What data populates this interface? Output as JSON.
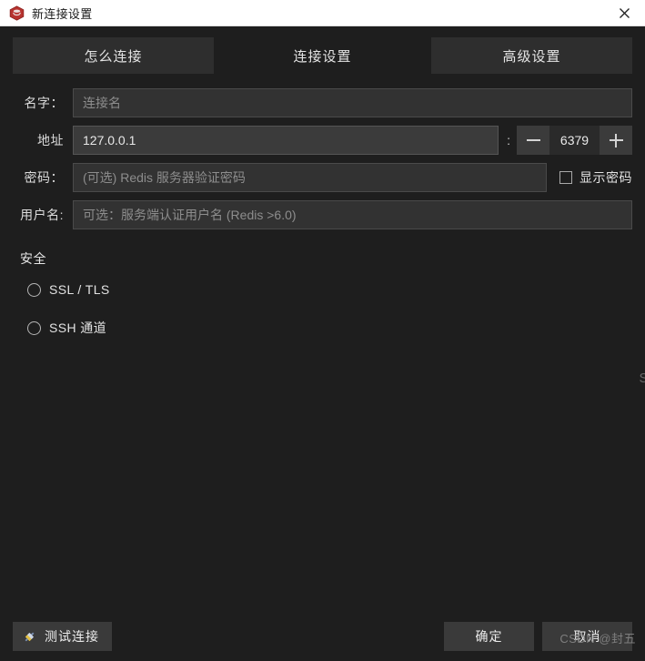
{
  "window": {
    "title": "新连接设置",
    "icon": "redis-logo-icon",
    "close_label": "✕",
    "bg": "#1e1e1e",
    "titlebar_bg": "#ffffff"
  },
  "tabs": [
    {
      "label": "怎么连接",
      "active": true
    },
    {
      "label": "连接设置",
      "active": false
    },
    {
      "label": "高级设置",
      "active": false
    }
  ],
  "form": {
    "name": {
      "label": "名字：",
      "value": "",
      "placeholder": "连接名"
    },
    "address": {
      "label": "地址",
      "value": "127.0.0.1",
      "placeholder": ""
    },
    "port": {
      "separator": ":",
      "value": "6379",
      "decrement_label": "−",
      "increment_label": "+"
    },
    "password": {
      "label": "密码：",
      "value": "",
      "placeholder": "(可选) Redis 服务器验证密码"
    },
    "show_password": {
      "label": "显示密码",
      "checked": false
    },
    "username": {
      "label": "用户名:",
      "value": "",
      "placeholder": "可选：服务端认证用户名 (Redis >6.0)"
    }
  },
  "security": {
    "title": "安全",
    "options": [
      {
        "label": "SSL / TLS",
        "selected": false
      },
      {
        "label": "SSH 通道",
        "selected": false
      }
    ]
  },
  "footer": {
    "test_label": "测试连接",
    "test_icon": "plug-icon",
    "ok_label": "确定",
    "cancel_label": "取消"
  },
  "watermarks": {
    "bottom": "CSDN @封五",
    "edge": "S"
  },
  "colors": {
    "accent_red": "#a82b2b",
    "surface": "#2e2e2e",
    "input": "#323232",
    "input_filled": "#3b3b3b",
    "button": "#3a3a3a"
  }
}
